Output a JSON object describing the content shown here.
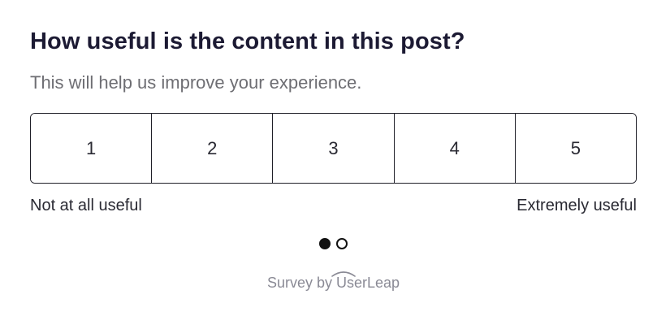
{
  "question": {
    "title": "How useful is the content in this post?",
    "subtitle": "This will help us improve your experience."
  },
  "scale": {
    "options": [
      "1",
      "2",
      "3",
      "4",
      "5"
    ],
    "low_label": "Not at all useful",
    "high_label": "Extremely useful"
  },
  "pager": {
    "current_page": 1,
    "total_pages": 2
  },
  "branding": {
    "prefix": "Survey by ",
    "brand": "UserLeap"
  },
  "colors": {
    "text_primary": "#1c1a33",
    "text_secondary": "#6e6e73",
    "border": "#1f1f28",
    "branding": "#8a8a95"
  }
}
